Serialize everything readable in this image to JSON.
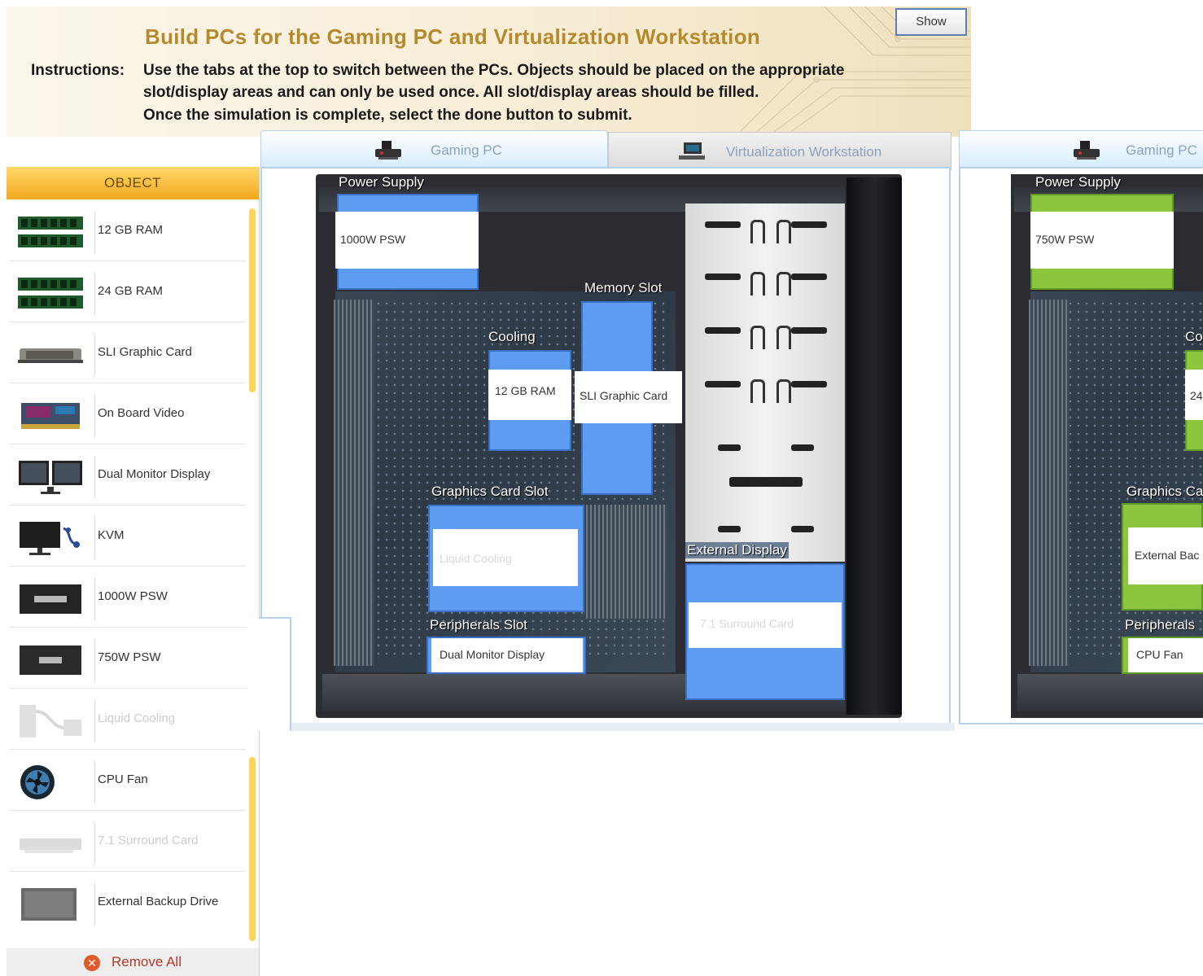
{
  "header": {
    "title": "Build PCs for the Gaming PC and Virtualization Workstation",
    "instructions_label": "Instructions:",
    "instructions_lines": [
      "Use the tabs at the top to switch between the PCs. Objects should be placed on the appropriate",
      "slot/display areas and can only be used once. All slot/display areas should be filled.",
      "Once the simulation is complete, select the done button to submit."
    ],
    "show_button": "Show"
  },
  "sidebar": {
    "header": "OBJECT",
    "items": [
      {
        "label": "12 GB RAM",
        "icon": "ram-icon",
        "used": false
      },
      {
        "label": "24 GB RAM",
        "icon": "ram-icon",
        "used": false
      },
      {
        "label": "SLI Graphic Card",
        "icon": "graphics-card-icon",
        "used": false
      },
      {
        "label": "On Board Video",
        "icon": "motherboard-icon",
        "used": false
      },
      {
        "label": "Dual Monitor Display",
        "icon": "dual-monitor-icon",
        "used": false
      },
      {
        "label": "KVM",
        "icon": "kvm-icon",
        "used": false
      },
      {
        "label": "1000W PSW",
        "icon": "psu-icon",
        "used": false
      },
      {
        "label": "750W PSW",
        "icon": "psu-icon",
        "used": false
      },
      {
        "label": "Liquid Cooling",
        "icon": "liquid-cooling-icon",
        "used": true
      },
      {
        "label": "CPU Fan",
        "icon": "cpu-fan-icon",
        "used": false
      },
      {
        "label": "7.1 Surround Card",
        "icon": "sound-card-icon",
        "used": true
      },
      {
        "label": "External Backup Drive",
        "icon": "backup-drive-icon",
        "used": false
      }
    ],
    "remove_all": "Remove All"
  },
  "tabs": [
    {
      "label": "Gaming PC",
      "active": true
    },
    {
      "label": "Virtualization Workstation",
      "active": false
    }
  ],
  "gaming_pc": {
    "power_supply": {
      "label": "Power Supply",
      "value": "1000W PSW"
    },
    "memory_slot": {
      "label": "Memory Slot",
      "value": "SLI Graphic Card"
    },
    "cooling": {
      "label": "Cooling",
      "value": "12 GB RAM"
    },
    "graphics_card_slot": {
      "label": "Graphics Card Slot",
      "value": "Liquid Cooling"
    },
    "peripherals_slot": {
      "label": "Peripherals Slot",
      "value": "Dual Monitor Display"
    },
    "external_display": {
      "label": "External Display",
      "value": "7.1 Surround Card"
    }
  },
  "duplicate_view": {
    "tab_label": "Gaming PC",
    "power_supply": {
      "label": "Power Supply",
      "value": "750W PSW"
    },
    "cooling_label": "Co",
    "cooling_value": "24",
    "graphics_label": "Graphics Ca",
    "graphics_value": "External Bac",
    "peripherals_label": "Peripherals",
    "peripherals_value": "CPU Fan"
  },
  "colors": {
    "title": "#b58a2c",
    "slot_blue": "#5d9cf0",
    "slot_green": "#8cc63f",
    "object_header": "#f2a81d"
  }
}
